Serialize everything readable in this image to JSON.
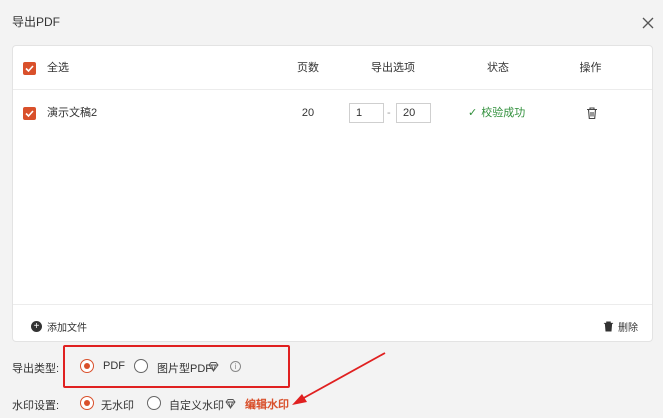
{
  "dialog": {
    "title": "导出PDF"
  },
  "table": {
    "headers": {
      "select_all": "全选",
      "pages": "页数",
      "range": "导出选项",
      "status": "状态",
      "action": "操作"
    },
    "rows": [
      {
        "name": "演示文稿2",
        "pages": "20",
        "range_from": "1",
        "range_sep": "-",
        "range_to": "20",
        "status": "校验成功"
      }
    ]
  },
  "footer": {
    "add_file": "添加文件",
    "delete": "删除"
  },
  "export_type": {
    "label": "导出类型:",
    "options": [
      {
        "label": "PDF",
        "selected": true
      },
      {
        "label": "图片型PDF",
        "selected": false
      }
    ]
  },
  "watermark": {
    "label": "水印设置:",
    "options": [
      {
        "label": "无水印",
        "selected": true
      },
      {
        "label": "自定义水印",
        "selected": false
      }
    ],
    "edit_label": "编辑水印"
  },
  "colors": {
    "accent": "#d9502b",
    "success": "#2f8f3a",
    "annotation": "#e02020"
  }
}
